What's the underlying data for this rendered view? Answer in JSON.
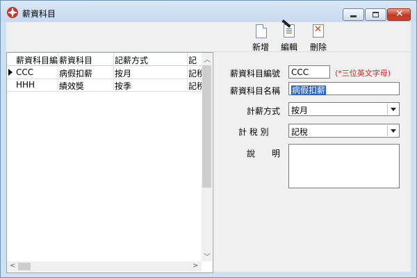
{
  "window": {
    "title": "薪資科目"
  },
  "toolbar": {
    "new_label": "新增",
    "edit_label": "編輯",
    "delete_label": "刪除"
  },
  "table": {
    "columns": [
      "薪資科目編",
      "薪資科目",
      "記薪方式",
      "記"
    ],
    "rows": [
      {
        "code": "CCC",
        "name": "病假扣薪",
        "method": "按月",
        "extra": "記稅",
        "selected": true
      },
      {
        "code": "HHH",
        "name": "績效獎",
        "method": "按季",
        "extra": "記稅",
        "selected": false
      }
    ]
  },
  "form": {
    "code_label": "薪資科目編號",
    "code_value": "CCC",
    "code_hint": "(*三位英文字母)",
    "name_label": "薪資科目名稱",
    "name_value": "病假扣薪",
    "method_label": "計薪方式",
    "method_value": "按月",
    "tax_label": "計 稅 別",
    "tax_value": "記稅",
    "desc_label": "說　　明",
    "desc_value": ""
  },
  "colors": {
    "hint": "#e02020",
    "selection": "#2a64c8",
    "titlebar": "#c6d9ef"
  }
}
